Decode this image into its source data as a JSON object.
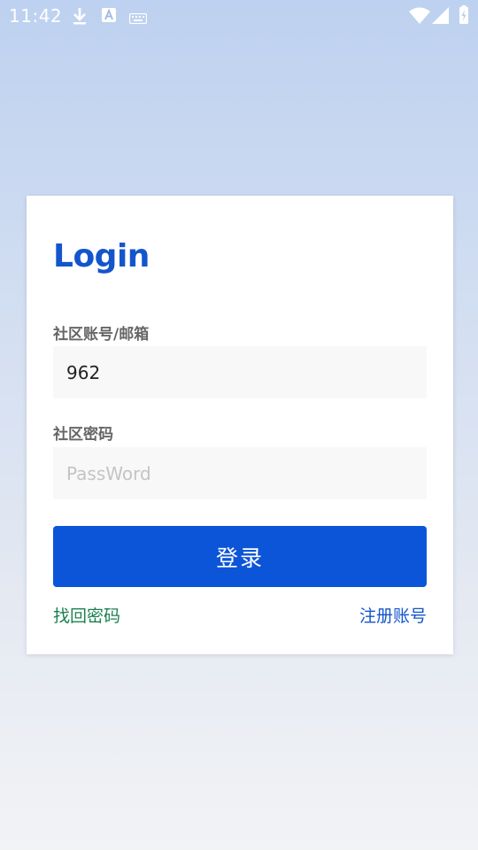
{
  "status_bar": {
    "time": "11:42",
    "icons": [
      "download-icon",
      "a-icon",
      "keyboard-icon",
      "wifi-icon",
      "signal-icon",
      "battery-icon"
    ]
  },
  "login": {
    "title": "Login",
    "account_label": "社区账号/邮箱",
    "account_value": "962",
    "password_label": "社区密码",
    "password_placeholder": "PassWord",
    "login_button": "登录",
    "forgot_link": "找回密码",
    "register_link": "注册账号"
  },
  "colors": {
    "primary": "#0d55d8",
    "title": "#1455cc",
    "forgot_link": "#1b8050",
    "input_bg": "#f8f8f8"
  }
}
